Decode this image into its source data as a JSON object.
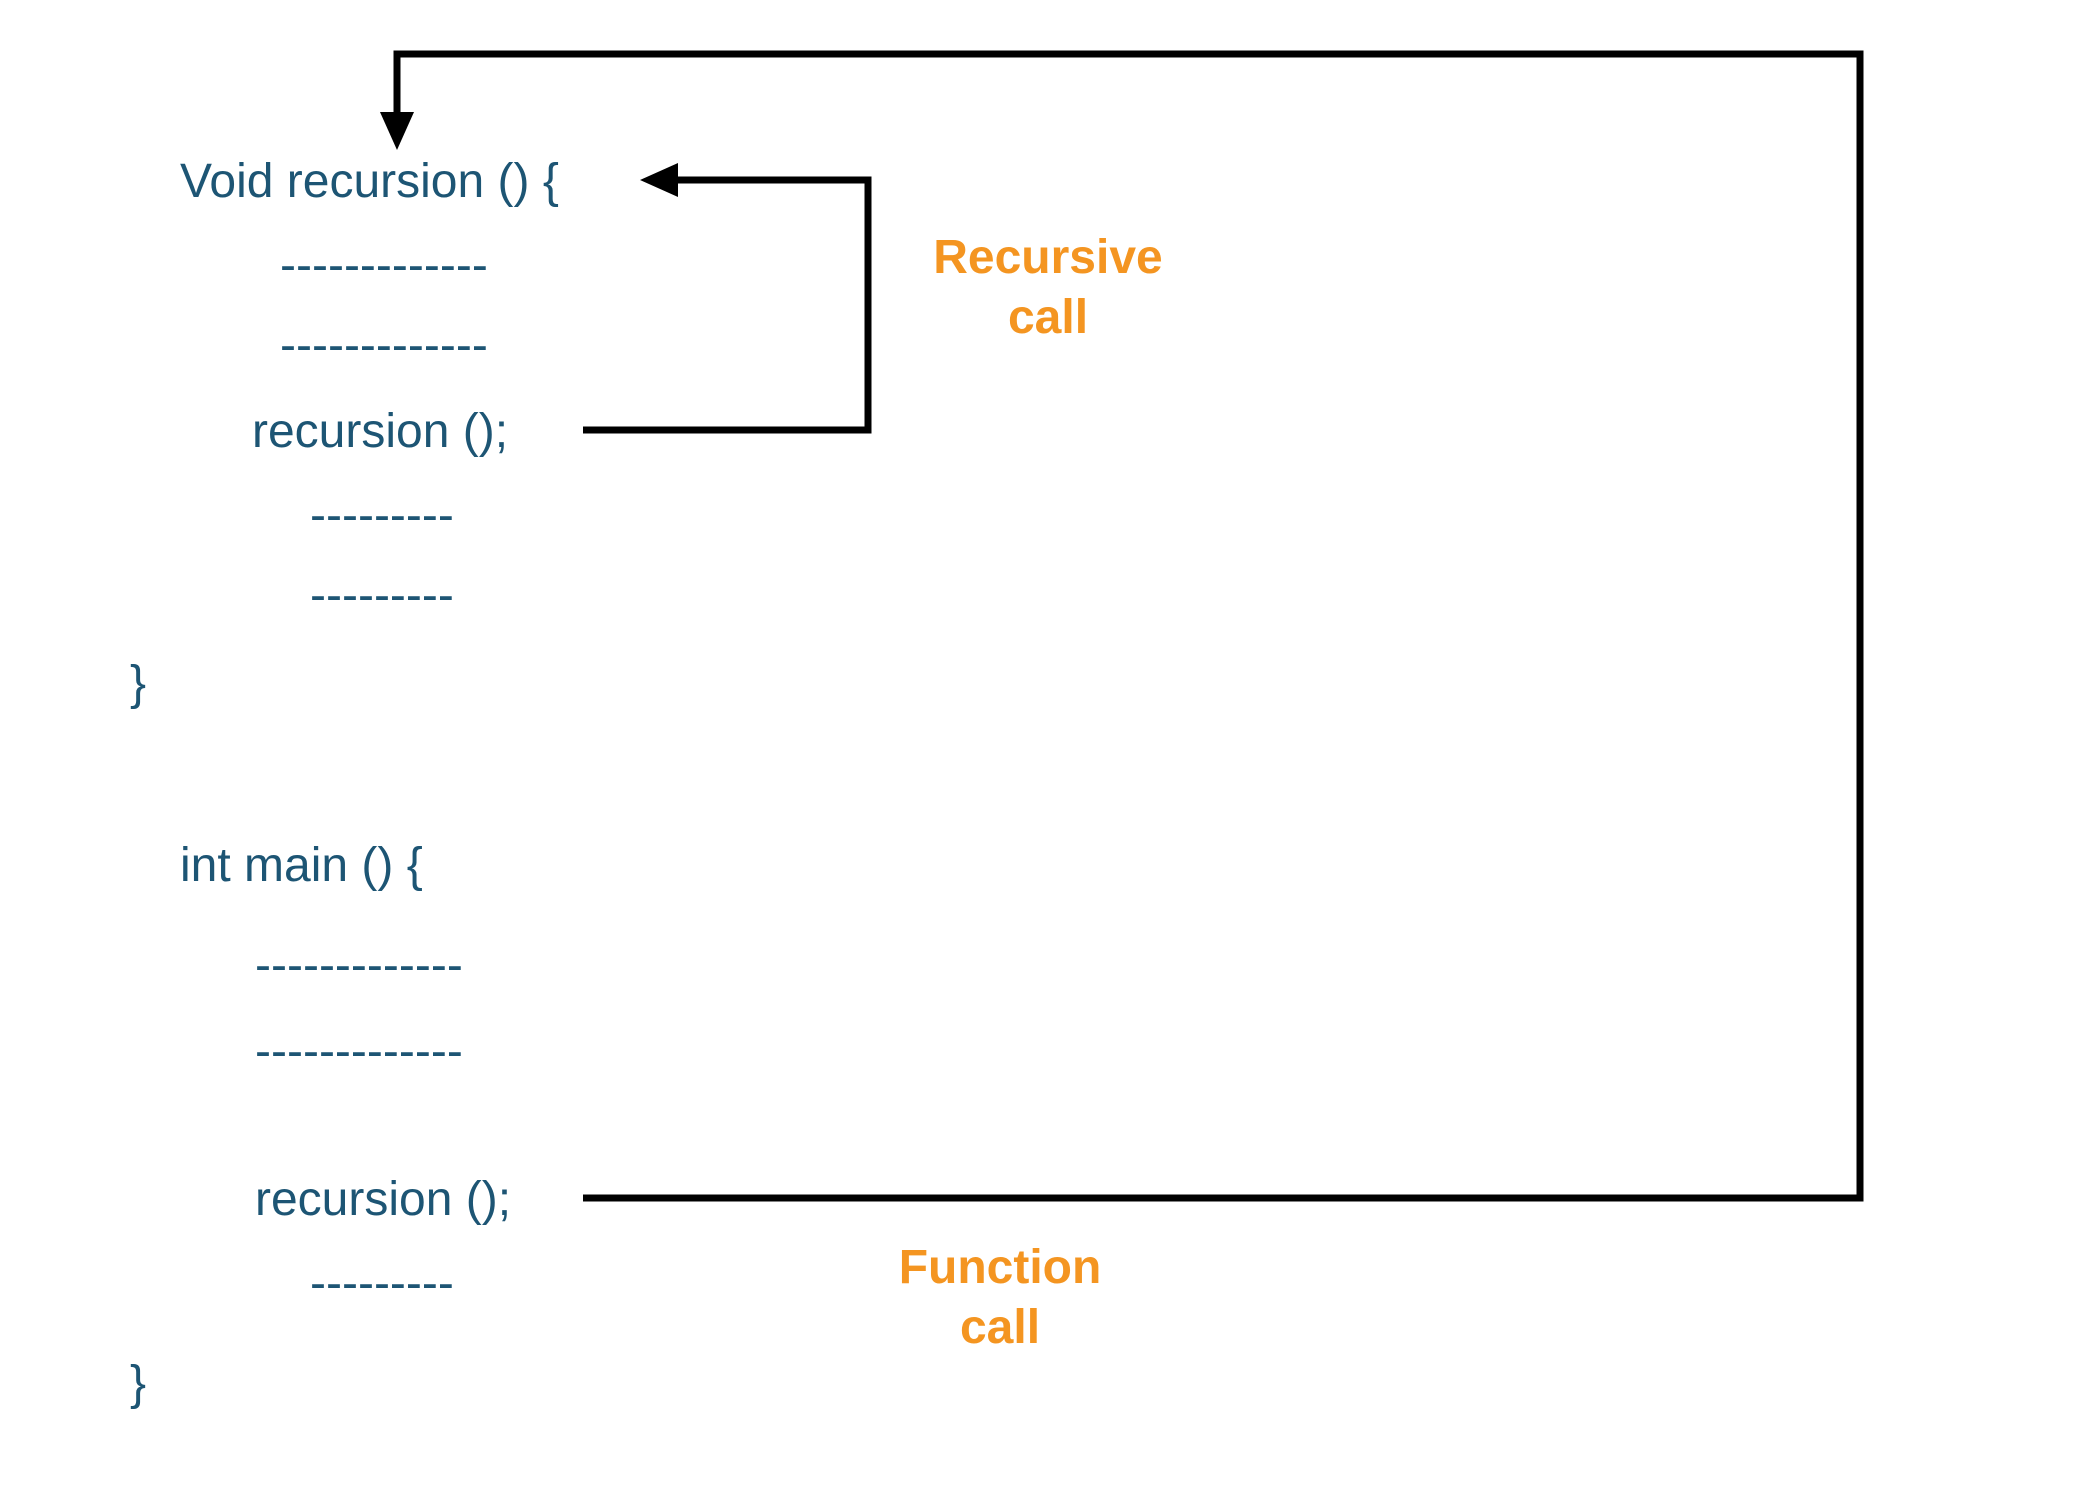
{
  "code": {
    "void_func": {
      "decl": "Void recursion () {",
      "dash1": "-------------",
      "dash2": "-------------",
      "call": "recursion ();",
      "dash3": "---------",
      "dash4": "---------",
      "close": "}"
    },
    "main_func": {
      "decl": "int main () {",
      "dash1": "-------------",
      "dash2": "-------------",
      "call": "recursion ();",
      "dash3": "---------",
      "close": "}"
    }
  },
  "labels": {
    "recursive_call_l1": "Recursive",
    "recursive_call_l2": "call",
    "function_call_l1": "Function",
    "function_call_l2": "call"
  },
  "colors": {
    "code": "#1d5574",
    "label": "#f49521",
    "arrow": "#000000"
  }
}
